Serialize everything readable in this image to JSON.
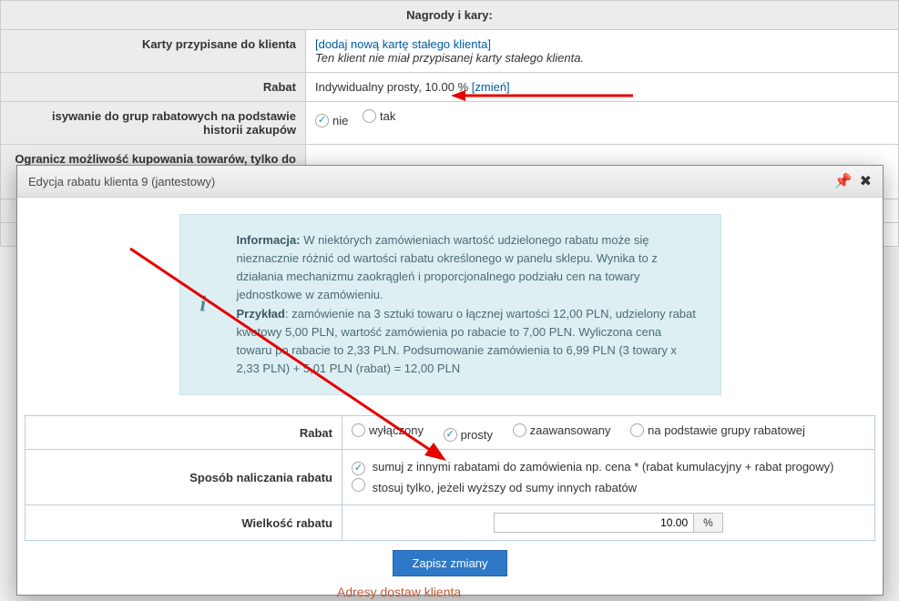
{
  "bg": {
    "nagrody": "Nagrody i kary:",
    "karty_label": "Karty przypisane do klienta",
    "karty_link": "[dodaj nową kartę stałego klienta]",
    "karty_info": "Ten klient nie miał przypisanej karty stałego klienta.",
    "rabat_label": "Rabat",
    "rabat_val": "Indywidualny prosty, 10.00 %",
    "rabat_change": "[zmień]",
    "przypis_label": "isywanie do grup rabatowych na podstawie historii zakupów",
    "radio_no": "nie",
    "radio_yes": "tak",
    "ogranicz_label": "Ogranicz możliwość kupowania towarów, tylko do tych,"
  },
  "modal": {
    "title": "Edycja rabatu klienta 9 (jantestowy)",
    "info_label1": "Informacja:",
    "info_body1": " W niektórych zamówieniach wartość udzielonego rabatu może się nieznacznie różnić od wartości rabatu określonego w panelu sklepu. Wynika to z działania mechanizmu zaokrągleń i proporcjonalnego podziału cen na towary jednostkowe w zamówieniu.",
    "info_label2": "Przykład",
    "info_body2": ": zamówienie na 3 sztuki towaru o łącznej wartości 12,00 PLN, udzielony rabat kwotowy 5,00 PLN, wartość zamówienia po rabacie to 7,00 PLN. Wyliczona cena towaru po rabacie to 2,33 PLN. Podsumowanie zamówienia to 6,99 PLN (3 towary x 2,33 PLN) + 5,01 PLN (rabat) = 12,00 PLN",
    "rabat_label": "Rabat",
    "rabat_opts": {
      "off": "wyłączony",
      "simple": "prosty",
      "adv": "zaawansowany",
      "group": "na podstawie grupy rabatowej"
    },
    "sposob_label": "Sposób naliczania rabatu",
    "sposob_opt1": "sumuj z innymi rabatami do zamówienia np. cena * (rabat kumulacyjny + rabat progowy)",
    "sposob_opt2": "stosuj tylko, jeżeli wyższy od sumy innych rabatów",
    "wielkosc_label": "Wielkość rabatu",
    "wielkosc_val": "10.00",
    "wielkosc_unit": "%",
    "save": "Zapisz zmiany"
  },
  "footer": "Adresy dostaw klienta"
}
